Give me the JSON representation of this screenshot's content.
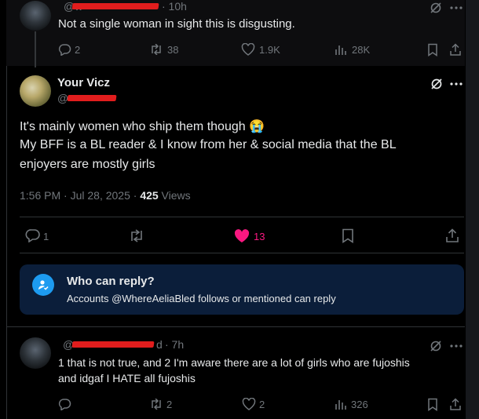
{
  "top_post": {
    "handle_prefix": "@w",
    "time": "· 10h",
    "text": "Not a single woman in sight this is disgusting.",
    "stats": {
      "replies": "2",
      "reposts": "38",
      "likes": "1.9K",
      "views": "28K"
    }
  },
  "main_post": {
    "display_name": "Your Vicz",
    "handle_prefix": "@",
    "text_line1": "It's mainly women who ship them though 😭",
    "text_line2": "My BFF is a BL reader & I know from her & social media that the BL",
    "text_line3": "enjoyers are mostly girls",
    "timestamp": "1:56 PM · Jul 28, 2025 · ",
    "views_count": "425",
    "views_label": " Views",
    "stats": {
      "replies": "1",
      "likes": "13"
    }
  },
  "reply_restriction": {
    "title": "Who can reply?",
    "text": "Accounts @WhereAeliaBled follows or mentioned can reply"
  },
  "bottom_post": {
    "handle_prefix": "@",
    "handle_tail": "d",
    "time": "· 7h",
    "text_line1": "1 that is not true, and 2 I'm aware there are a lot of girls who are fujoshis",
    "text_line2": "and idgaf I HATE all fujoshis",
    "stats": {
      "reposts": "2",
      "likes": "2",
      "views": "326"
    }
  },
  "colors": {
    "like_active": "#f91880",
    "accent": "#1d9bf0",
    "muted": "#71767b",
    "redaction": "#e11d1d"
  },
  "icons": [
    "grok-icon",
    "more-icon",
    "reply-icon",
    "repost-icon",
    "like-icon",
    "views-icon",
    "bookmark-icon",
    "share-icon"
  ]
}
